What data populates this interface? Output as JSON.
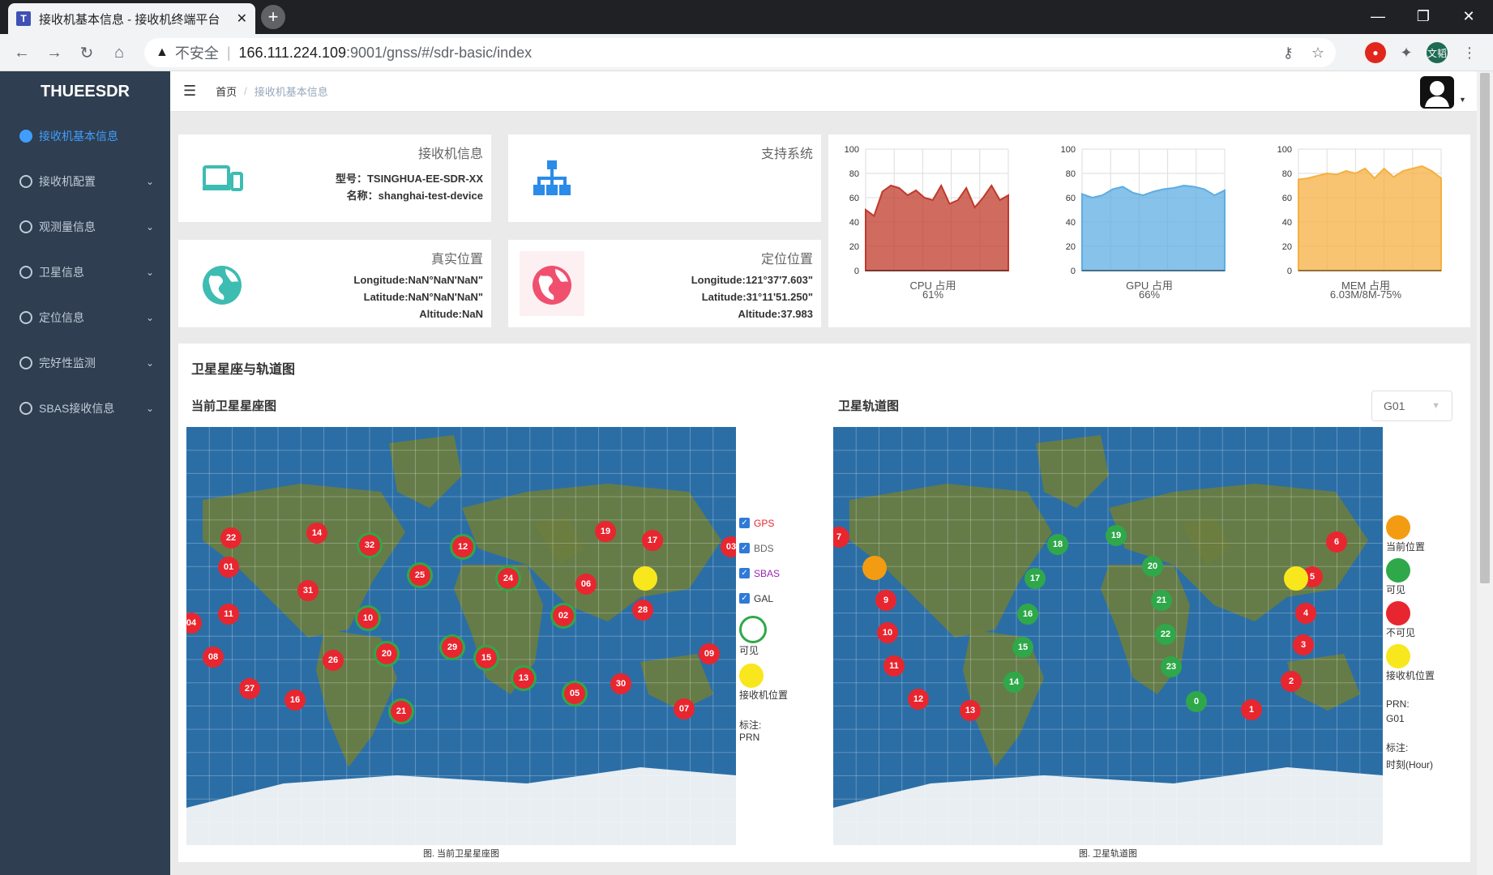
{
  "browser": {
    "tab_title": "接收机基本信息 - 接收机终端平台",
    "tab_favicon": "T",
    "url_insecure": "不安全",
    "url_host": "166.111.224.109",
    "url_rest": ":9001/gnss/#/sdr-basic/index",
    "profile_label": "文韬"
  },
  "sidebar": {
    "brand": "THUEESDR",
    "items": [
      {
        "label": "接收机基本信息",
        "icon": "info-icon",
        "active": true
      },
      {
        "label": "接收机配置",
        "icon": "gear-icon"
      },
      {
        "label": "观测量信息",
        "icon": "eye-icon"
      },
      {
        "label": "卫星信息",
        "icon": "info-icon"
      },
      {
        "label": "定位信息",
        "icon": "location-pin-icon"
      },
      {
        "label": "完好性监测",
        "icon": "settings-icon"
      },
      {
        "label": "SBAS接收信息",
        "icon": "link-icon"
      }
    ]
  },
  "header": {
    "breadcrumb_home": "首页",
    "breadcrumb_current": "接收机基本信息"
  },
  "receiver_card": {
    "title": "接收机信息",
    "model": "型号：TSINGHUA-EE-SDR-XX",
    "name": "名称：shanghai-test-device"
  },
  "systems_card": {
    "title": "支持系统"
  },
  "true_pos": {
    "title": "真实位置",
    "lon": "Longitude:NaN°NaN'NaN\"",
    "lat": "Latitude:NaN°NaN'NaN\"",
    "alt": "Altitude:NaN"
  },
  "fix_pos": {
    "title": "定位位置",
    "lon": "Longitude:121°37'7.603\"",
    "lat": "Latitude:31°11'51.250\"",
    "alt": "Altitude:37.983"
  },
  "charts": [
    {
      "type": "area",
      "title": "CPU 占用",
      "value": "61%",
      "color": "#c0392b",
      "ylim": [
        0,
        100
      ],
      "y_ticks": [
        0,
        20,
        40,
        60,
        80,
        100
      ],
      "values": [
        50,
        45,
        65,
        70,
        68,
        62,
        66,
        60,
        58,
        70,
        55,
        58,
        68,
        52,
        60,
        70,
        58,
        62
      ]
    },
    {
      "type": "area",
      "title": "GPU 占用",
      "value": "66%",
      "color": "#5dade2",
      "ylim": [
        0,
        100
      ],
      "y_ticks": [
        0,
        20,
        40,
        60,
        80,
        100
      ],
      "values": [
        63,
        60,
        62,
        67,
        69,
        64,
        62,
        65,
        67,
        68,
        70,
        69,
        67,
        62,
        66
      ]
    },
    {
      "type": "area",
      "title": "MEM 占用",
      "value": "6.03M/8M-75%",
      "color": "#f5b041",
      "ylim": [
        0,
        100
      ],
      "y_ticks": [
        0,
        20,
        40,
        60,
        80,
        100
      ],
      "values": [
        75,
        76,
        78,
        80,
        79,
        82,
        80,
        84,
        76,
        84,
        77,
        82,
        84,
        86,
        82,
        76
      ]
    }
  ],
  "panel": {
    "title": "卫星星座与轨道图",
    "left_title": "当前卫星星座图",
    "right_title": "卫星轨道图",
    "left_caption": "图. 当前卫星星座图",
    "right_caption": "图. 卫星轨道图",
    "select_value": "G01"
  },
  "legend_left": {
    "gps": "GPS",
    "bds": "BDS",
    "sbas": "SBAS",
    "gal": "GAL",
    "visible": "可见",
    "receiver": "接收机位置",
    "note_label": "标注:",
    "note_value": "PRN",
    "gps_color": "#e8262f",
    "bds_color": "#666666",
    "sbas_color": "#9b27af",
    "gal_color": "#333333"
  },
  "legend_right": {
    "current": "当前位置",
    "visible": "可见",
    "invisible": "不可见",
    "receiver": "接收机位置",
    "prn_label": "PRN:",
    "prn_value": "G01",
    "note_label": "标注:",
    "note_value": "时刻(Hour)"
  },
  "left_sats": [
    {
      "id": "22",
      "s": "red"
    },
    {
      "id": "14",
      "s": "red"
    },
    {
      "id": "32",
      "s": "redg"
    },
    {
      "id": "12",
      "s": "redg"
    },
    {
      "id": "19",
      "s": "red"
    },
    {
      "id": "17",
      "s": "red"
    },
    {
      "id": "03",
      "s": "red"
    },
    {
      "id": "01",
      "s": "red"
    },
    {
      "id": "25",
      "s": "redg"
    },
    {
      "id": "24",
      "s": "redg"
    },
    {
      "id": "06",
      "s": "red"
    },
    {
      "id": "31",
      "s": "red"
    },
    {
      "id": "11",
      "s": "red"
    },
    {
      "id": "10",
      "s": "redg"
    },
    {
      "id": "02",
      "s": "redg"
    },
    {
      "id": "28",
      "s": "red"
    },
    {
      "id": "04",
      "s": "red"
    },
    {
      "id": "08",
      "s": "red"
    },
    {
      "id": "26",
      "s": "red"
    },
    {
      "id": "20",
      "s": "redg"
    },
    {
      "id": "29",
      "s": "redg"
    },
    {
      "id": "15",
      "s": "redg"
    },
    {
      "id": "09",
      "s": "red"
    },
    {
      "id": "13",
      "s": "redg"
    },
    {
      "id": "27",
      "s": "red"
    },
    {
      "id": "05",
      "s": "redg"
    },
    {
      "id": "30",
      "s": "red"
    },
    {
      "id": "16",
      "s": "red"
    },
    {
      "id": "21",
      "s": "redg"
    },
    {
      "id": "07",
      "s": "red"
    },
    {
      "id": "",
      "s": "yel"
    }
  ],
  "right_sats": [
    {
      "id": "7",
      "s": "red"
    },
    {
      "id": "18",
      "s": "green"
    },
    {
      "id": "19",
      "s": "green"
    },
    {
      "id": "6",
      "s": "red"
    },
    {
      "id": "",
      "s": "org"
    },
    {
      "id": "17",
      "s": "green"
    },
    {
      "id": "20",
      "s": "green"
    },
    {
      "id": "5",
      "s": "red"
    },
    {
      "id": "9",
      "s": "red"
    },
    {
      "id": "21",
      "s": "green"
    },
    {
      "id": "16",
      "s": "green"
    },
    {
      "id": "4",
      "s": "red"
    },
    {
      "id": "10",
      "s": "red"
    },
    {
      "id": "22",
      "s": "green"
    },
    {
      "id": "15",
      "s": "green"
    },
    {
      "id": "3",
      "s": "red"
    },
    {
      "id": "11",
      "s": "red"
    },
    {
      "id": "23",
      "s": "green"
    },
    {
      "id": "14",
      "s": "green"
    },
    {
      "id": "2",
      "s": "red"
    },
    {
      "id": "12",
      "s": "red"
    },
    {
      "id": "13",
      "s": "red"
    },
    {
      "id": "0",
      "s": "green"
    },
    {
      "id": "1",
      "s": "red"
    },
    {
      "id": "",
      "s": "yel"
    }
  ]
}
